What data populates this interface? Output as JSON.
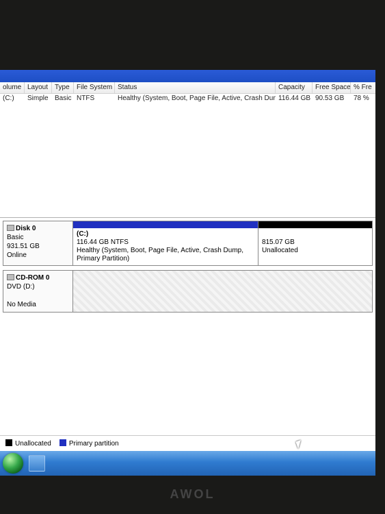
{
  "columns": {
    "volume": "olume",
    "layout": "Layout",
    "type": "Type",
    "fs": "File System",
    "status": "Status",
    "capacity": "Capacity",
    "free": "Free Space",
    "pct": "% Fre"
  },
  "volume_row": {
    "volume": "(C:)",
    "layout": "Simple",
    "type": "Basic",
    "fs": "NTFS",
    "status": "Healthy (System, Boot, Page File, Active, Crash Dump, Primary Partition)",
    "capacity": "116.44 GB",
    "free": "90.53 GB",
    "pct": "78 %"
  },
  "disk0": {
    "title": "Disk 0",
    "type": "Basic",
    "size": "931.51 GB",
    "status": "Online",
    "part_c": {
      "name": "(C:)",
      "detail": "116.44 GB NTFS",
      "status": "Healthy (System, Boot, Page File, Active, Crash Dump, Primary Partition)"
    },
    "part_un": {
      "size": "815.07 GB",
      "label": "Unallocated"
    }
  },
  "cdrom": {
    "title": "CD-ROM 0",
    "device": "DVD (D:)",
    "status": "No Media"
  },
  "legend": {
    "unalloc": "Unallocated",
    "primary": "Primary partition"
  },
  "brand": "AWOL"
}
